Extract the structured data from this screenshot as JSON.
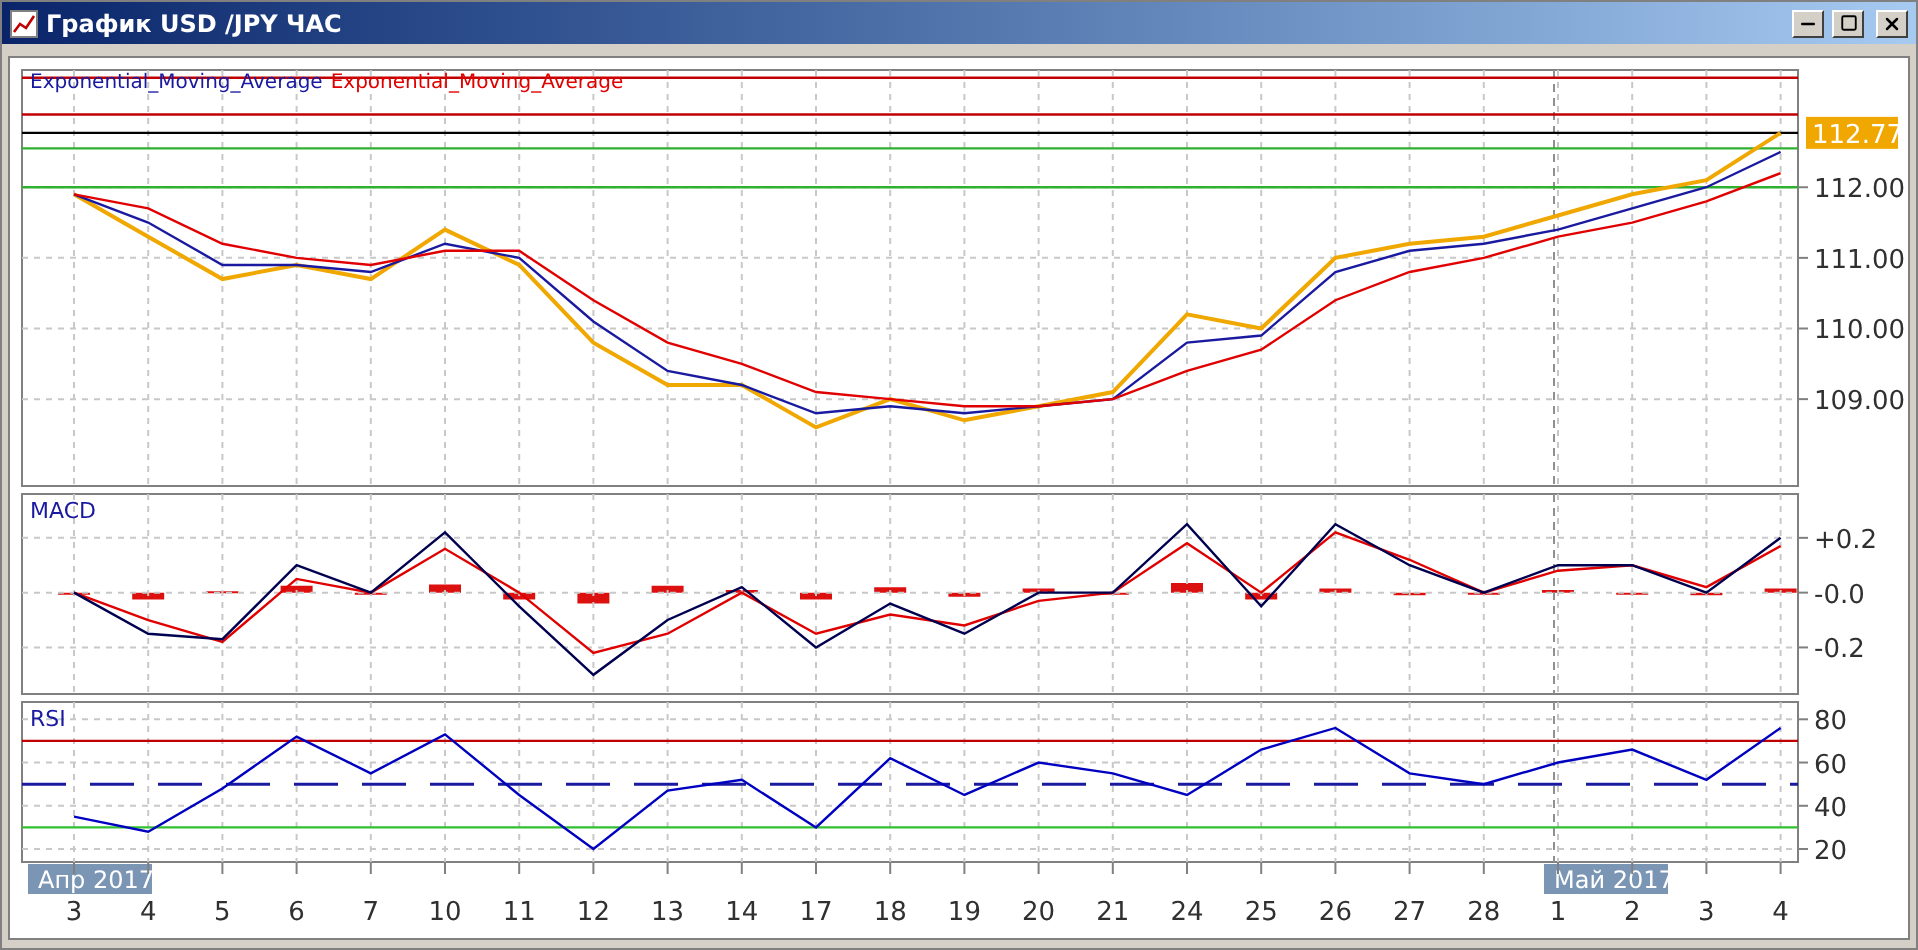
{
  "window": {
    "title": "График USD /JPY ЧАС"
  },
  "price_panel": {
    "chart_data": {
      "type": "line",
      "ylim": [
        107.77,
        113.66
      ],
      "grid": true,
      "yticks": [
        {
          "value": 109,
          "label": "109.00"
        },
        {
          "value": 110,
          "label": "110.00"
        },
        {
          "value": 111,
          "label": "111.00"
        },
        {
          "value": 112,
          "label": "112.00"
        }
      ],
      "series": [
        {
          "color": "#f0a800",
          "values": [
            111.9,
            111.3,
            110.7,
            110.9,
            110.7,
            111.4,
            110.9,
            109.8,
            109.2,
            109.2,
            108.6,
            109.0,
            108.7,
            108.9,
            109.1,
            110.2,
            110.0,
            111.0,
            111.2,
            111.3,
            111.6,
            111.9,
            112.1,
            112.77
          ]
        },
        {
          "name": "Exponential_Moving_Average",
          "color": "#1a1aa0",
          "values": [
            111.9,
            111.5,
            110.9,
            110.9,
            110.8,
            111.2,
            111.0,
            110.1,
            109.4,
            109.2,
            108.8,
            108.9,
            108.8,
            108.9,
            109.0,
            109.8,
            109.9,
            110.8,
            111.1,
            111.2,
            111.4,
            111.7,
            112.0,
            112.5
          ]
        },
        {
          "name": "Exponential_Moving_Average",
          "color": "#e00000",
          "values": [
            111.9,
            111.7,
            111.2,
            111.0,
            110.9,
            111.1,
            111.1,
            110.4,
            109.8,
            109.5,
            109.1,
            109.0,
            108.9,
            108.9,
            109.0,
            109.4,
            109.7,
            110.4,
            110.8,
            111.0,
            111.3,
            111.5,
            111.8,
            112.2
          ]
        }
      ],
      "ref_lines": [
        {
          "axis": "y",
          "value": 113.55,
          "color": "#c00000"
        },
        {
          "axis": "y",
          "value": 113.03,
          "color": "#c00000"
        },
        {
          "axis": "y",
          "value": 112.77,
          "color": "#000000",
          "label": "112.77"
        },
        {
          "axis": "y",
          "value": 112.55,
          "color": "#30b030"
        },
        {
          "axis": "y",
          "value": 112.0,
          "color": "#30b030"
        }
      ]
    }
  },
  "macd_panel": {
    "chart_data": {
      "type": "line",
      "title": "MACD",
      "ylim": [
        -0.37,
        0.36
      ],
      "grid": true,
      "yticks": [
        {
          "value": 0.2,
          "label": "+0.2"
        },
        {
          "value": 0,
          "label": "-0.0"
        },
        {
          "value": -0.2,
          "label": "-0.2"
        }
      ],
      "series": [
        {
          "color": "#e00000",
          "values": [
            0,
            -0.1,
            -0.18,
            0.05,
            0.0,
            0.16,
            0.0,
            -0.22,
            -0.15,
            0.0,
            -0.15,
            -0.08,
            -0.12,
            -0.03,
            0.0,
            0.18,
            0.0,
            0.22,
            0.12,
            0.0,
            0.08,
            0.1,
            0.02,
            0.17
          ]
        },
        {
          "color": "#000050",
          "values": [
            0,
            -0.15,
            -0.17,
            0.1,
            0.0,
            0.22,
            -0.05,
            -0.3,
            -0.1,
            0.02,
            -0.2,
            -0.04,
            -0.15,
            0.0,
            0.0,
            0.25,
            -0.05,
            0.25,
            0.1,
            0.0,
            0.1,
            0.1,
            0.0,
            0.2
          ]
        }
      ]
    }
  },
  "rsi_panel": {
    "chart_data": {
      "type": "line",
      "title": "RSI",
      "categories": [
        "3",
        "4",
        "5",
        "6",
        "7",
        "10",
        "11",
        "12",
        "13",
        "14",
        "17",
        "18",
        "19",
        "20",
        "21",
        "24",
        "25",
        "26",
        "27",
        "28",
        "1",
        "2",
        "3",
        "4"
      ],
      "ylim": [
        14,
        88
      ],
      "grid": true,
      "yticks": [
        {
          "value": 20,
          "label": "20"
        },
        {
          "value": 40,
          "label": "40"
        },
        {
          "value": 60,
          "label": "60"
        },
        {
          "value": 80,
          "label": "80"
        }
      ],
      "series": [
        {
          "color": "#0000c0",
          "values": [
            35,
            28,
            48,
            72,
            55,
            73,
            45,
            20,
            47,
            52,
            30,
            62,
            45,
            60,
            55,
            45,
            66,
            76,
            55,
            50,
            60,
            66,
            52,
            76
          ]
        }
      ],
      "ref_lines": [
        {
          "axis": "y",
          "value": 70,
          "color": "#c00000"
        },
        {
          "axis": "y",
          "value": 50,
          "color": "#1a1aa0"
        },
        {
          "axis": "y",
          "value": 30,
          "color": "#30c030"
        },
        {
          "axis": "x",
          "value": "1",
          "color": "#909090"
        }
      ]
    },
    "months": [
      {
        "text": "Апр 2017"
      },
      {
        "text": "Май 2017"
      }
    ]
  }
}
